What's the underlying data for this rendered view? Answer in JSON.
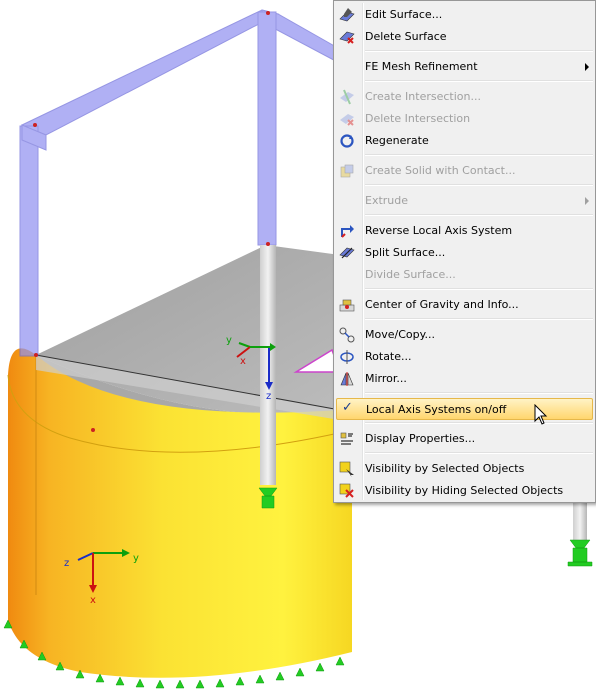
{
  "menu": {
    "items": [
      {
        "label": "Edit Surface...",
        "icon": "edit-surface-icon",
        "disabled": false
      },
      {
        "label": "Delete Surface",
        "icon": "delete-surface-icon",
        "disabled": false
      },
      {
        "label": "FE Mesh Refinement",
        "icon": "",
        "disabled": false,
        "submenu": true
      },
      {
        "label": "Create Intersection...",
        "icon": "create-intersection-icon",
        "disabled": true
      },
      {
        "label": "Delete Intersection",
        "icon": "delete-intersection-icon",
        "disabled": true
      },
      {
        "label": "Regenerate",
        "icon": "regenerate-icon",
        "disabled": false
      },
      {
        "label": "Create Solid with Contact...",
        "icon": "create-solid-icon",
        "disabled": true
      },
      {
        "label": "Extrude",
        "icon": "",
        "disabled": true,
        "submenu": true
      },
      {
        "label": "Reverse Local Axis System",
        "icon": "reverse-axis-icon",
        "disabled": false
      },
      {
        "label": "Split Surface...",
        "icon": "split-surface-icon",
        "disabled": false
      },
      {
        "label": "Divide Surface...",
        "icon": "",
        "disabled": true
      },
      {
        "label": "Center of Gravity and Info...",
        "icon": "center-of-gravity-icon",
        "disabled": false
      },
      {
        "label": "Move/Copy...",
        "icon": "move-copy-icon",
        "disabled": false
      },
      {
        "label": "Rotate...",
        "icon": "rotate-icon",
        "disabled": false
      },
      {
        "label": "Mirror...",
        "icon": "mirror-icon",
        "disabled": false
      },
      {
        "label": "Local Axis Systems on/off",
        "icon": "checkmark-icon",
        "disabled": false,
        "checked": true,
        "highlighted": true
      },
      {
        "label": "Display Properties...",
        "icon": "display-properties-icon",
        "disabled": false
      },
      {
        "label": "Visibility by Selected Objects",
        "icon": "visibility-selected-icon",
        "disabled": false
      },
      {
        "label": "Visibility by Hiding Selected Objects",
        "icon": "visibility-hiding-icon",
        "disabled": false
      }
    ],
    "check_glyph": "✓"
  },
  "axes": {
    "top": {
      "y": "y",
      "x": "x",
      "z": "z"
    },
    "front": {
      "z": "z",
      "y": "y",
      "x": "x"
    }
  },
  "colors": {
    "surface_yellow": "#f8d81a",
    "member_blue": "#8f8ff0",
    "support_green": "#22cc22",
    "highlight": "#ffd66e"
  }
}
